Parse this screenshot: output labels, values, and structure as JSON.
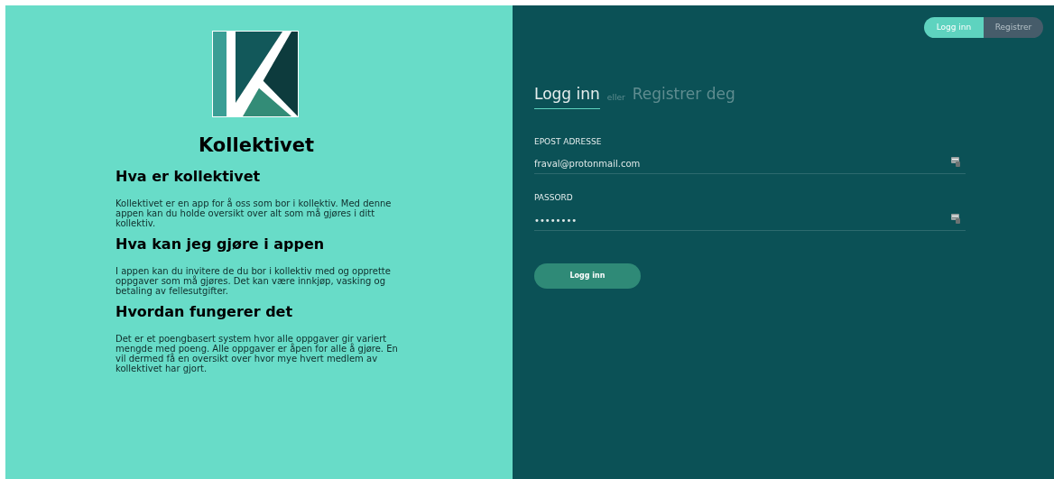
{
  "info": {
    "title": "Kollektivet",
    "sections": [
      {
        "heading": "Hva er kollektivet",
        "text": "Kollektivet er en app for å oss som bor i kollektiv. Med denne appen kan du holde oversikt over alt som må gjøres i ditt kollektiv."
      },
      {
        "heading": "Hva kan jeg gjøre i appen",
        "text": "I appen kan du invitere de du bor i kollektiv med og opprette oppgaver som må gjøres. Det kan være innkjøp, vasking og betaling av fellesutgifter."
      },
      {
        "heading": "Hvordan fungerer det",
        "text": "Det er et poengbasert system hvor alle oppgaver gir variert mengde med poeng. Alle oppgaver er åpen for alle å gjøre. En vil dermed få en oversikt over hvor mye hvert medlem av kollektivet har gjort."
      }
    ]
  },
  "top_toggle": [
    {
      "label": "Logg inn",
      "selected": true
    },
    {
      "label": "Registrer",
      "selected": false
    }
  ],
  "form_tabs": {
    "items": [
      {
        "label": "Logg inn",
        "selected": true
      },
      {
        "label": "Registrer deg",
        "selected": false
      }
    ],
    "separator": "eller"
  },
  "fields": [
    {
      "label": "EPOST ADRESSE",
      "value": "fraval@protonmail.com"
    },
    {
      "label": "PASSORD",
      "value": "••••••••"
    }
  ],
  "submit": "Logg inn"
}
